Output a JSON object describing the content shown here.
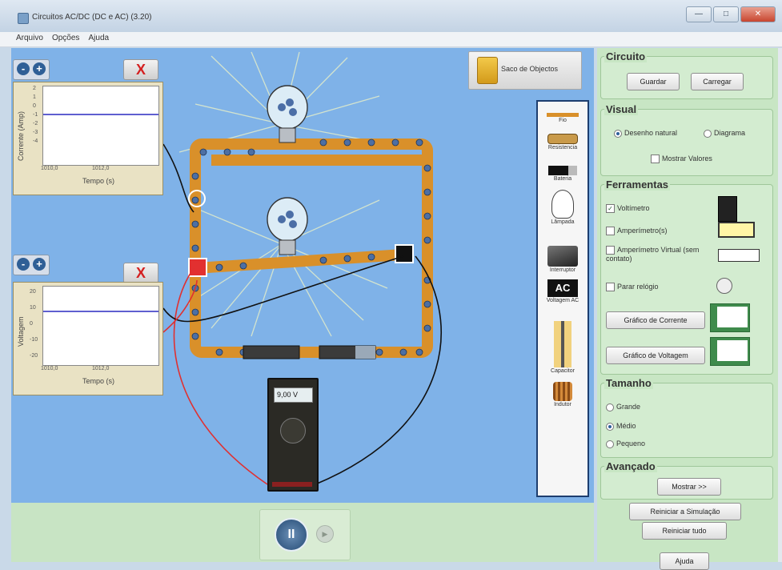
{
  "window": {
    "title": "Circuitos AC/DC (DC e AC) (3.20)",
    "min_icon": "minimize-icon",
    "max_icon": "maximize-icon",
    "close_icon": "close-icon"
  },
  "menu": [
    "Arquivo",
    "Opções",
    "Ajuda"
  ],
  "graphs": [
    {
      "ylabel": "Corrente (Amp)",
      "xlabel": "Tempo (s)",
      "yticks": [
        "2",
        "1",
        "0",
        "-1",
        "-2",
        "-3",
        "-4"
      ],
      "xticks": [
        "1010,0",
        "1012,0"
      ],
      "close_label": "X",
      "zoom_out": "-",
      "zoom_in": "+"
    },
    {
      "ylabel": "Voltagem",
      "xlabel": "Tempo (s)",
      "yticks": [
        "20",
        "10",
        "0",
        "-10",
        "-20"
      ],
      "xticks": [
        "1010,0",
        "1012,0"
      ],
      "close_label": "X",
      "zoom_out": "-",
      "zoom_in": "+"
    }
  ],
  "bag": {
    "label": "Saco de Objectos"
  },
  "toolbox": {
    "items": [
      {
        "label": "Fio",
        "icon": "wire-icon"
      },
      {
        "label": "Resistencia",
        "icon": "resistor-icon"
      },
      {
        "label": "Bateria",
        "icon": "battery-icon"
      },
      {
        "label": "Lâmpada",
        "icon": "bulb-icon"
      },
      {
        "label": "Interruptor",
        "icon": "switch-icon"
      },
      {
        "label": "Voltagem AC",
        "icon": "ac-source-icon",
        "badge": "AC"
      },
      {
        "label": "Capacitor",
        "icon": "capacitor-icon"
      },
      {
        "label": "Indutor",
        "icon": "inductor-icon"
      }
    ]
  },
  "multimeter": {
    "reading": "9,00 V"
  },
  "playback": {
    "pause_label": "II",
    "step_label": "▶"
  },
  "panel": {
    "circuito": {
      "heading": "Circuito",
      "save": "Guardar",
      "load": "Carregar"
    },
    "visual": {
      "heading": "Visual",
      "natural": "Desenho natural",
      "diagram": "Diagrama",
      "show_values": "Mostrar Valores"
    },
    "ferramentas": {
      "heading": "Ferramentas",
      "voltmeter": "Voltímetro",
      "ammeters": "Amperímetro(s)",
      "virtual_ammeter": "Amperímetro Virtual (sem contato)",
      "stop_clock": "Parar relógio",
      "current_chart": "Gráfico de Corrente",
      "voltage_chart": "Gráfico de Voltagem"
    },
    "tamanho": {
      "heading": "Tamanho",
      "large": "Grande",
      "medium": "Médio",
      "small": "Pequeno"
    },
    "avancado": {
      "heading": "Avançado",
      "show_more": "Mostrar >>"
    },
    "reset_sim": "Reiniciar a Simulação",
    "reset_all": "Reiniciar tudo",
    "help": "Ajuda"
  }
}
